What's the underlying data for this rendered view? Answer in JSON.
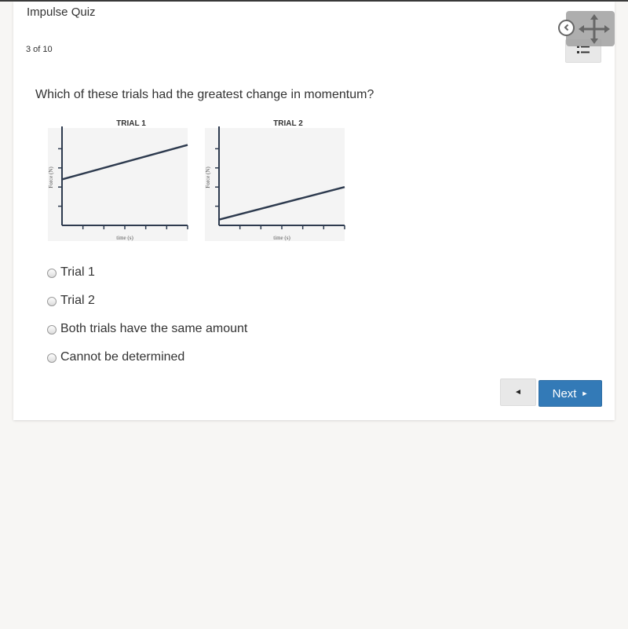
{
  "quiz": {
    "title": "Impulse Quiz",
    "progress": "3 of 10",
    "question": "Which of these trials had the greatest change in momentum?"
  },
  "toolbar": {
    "back_icon": "chevron-left-circle-icon",
    "move_icon": "move-arrows-icon",
    "list_icon": "list-icon"
  },
  "options": [
    {
      "label": "Trial 1",
      "selected": false
    },
    {
      "label": "Trial 2",
      "selected": false
    },
    {
      "label": "Both trials have the same amount",
      "selected": false
    },
    {
      "label": "Cannot be determined",
      "selected": false
    }
  ],
  "navigation": {
    "prev_label": "◄",
    "next_label": "Next",
    "next_arrow": "►"
  },
  "colors": {
    "primary": "#337ab7",
    "page_bg": "#f7f6f4",
    "line": "#2d3a4e"
  },
  "chart_data": [
    {
      "type": "line",
      "title": "TRIAL 1",
      "xlabel": "time (s)",
      "ylabel": "Force (N)",
      "xlim": [
        0,
        6
      ],
      "ylim": [
        0,
        5
      ],
      "x_ticks": [
        1,
        2,
        3,
        4,
        5,
        6
      ],
      "y_ticks": [
        1,
        2,
        3,
        4
      ],
      "grid": false,
      "series": [
        {
          "name": "Trial 1",
          "x": [
            0,
            6
          ],
          "y": [
            2.4,
            4.2
          ]
        }
      ]
    },
    {
      "type": "line",
      "title": "TRIAL 2",
      "xlabel": "time (s)",
      "ylabel": "Force (N)",
      "xlim": [
        0,
        6
      ],
      "ylim": [
        0,
        5
      ],
      "x_ticks": [
        1,
        2,
        3,
        4,
        5,
        6
      ],
      "y_ticks": [
        1,
        2,
        3,
        4
      ],
      "grid": false,
      "series": [
        {
          "name": "Trial 2",
          "x": [
            0,
            6
          ],
          "y": [
            0.3,
            2.0
          ]
        }
      ]
    }
  ]
}
